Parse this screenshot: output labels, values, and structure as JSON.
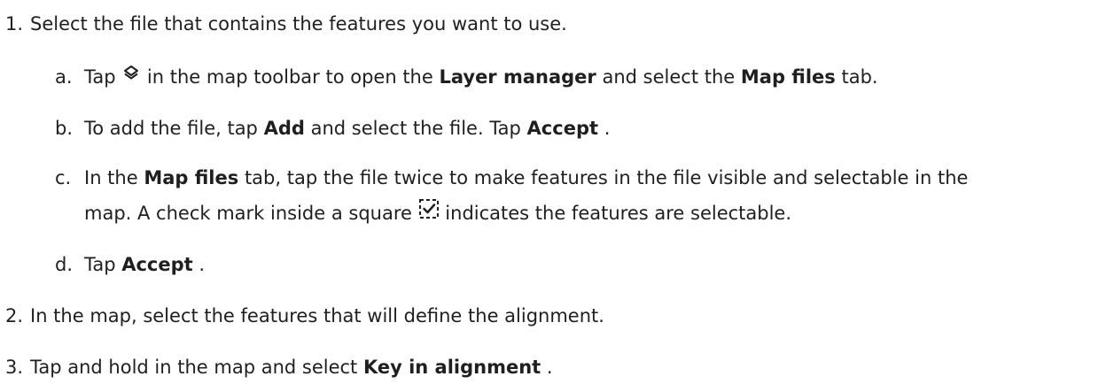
{
  "steps": [
    {
      "marker": "1.",
      "text": "Select the file that contains the features you want to use."
    },
    {
      "marker": "2.",
      "text": "In the map, select the features that will define the alignment."
    },
    {
      "marker": "3.",
      "text_before": "Tap and hold in the map and select ",
      "bold": "Key in alignment",
      "text_after": "."
    }
  ],
  "substeps": {
    "a": {
      "marker": "a.",
      "t1": "Tap ",
      "icon": "layers-icon",
      "t2": " in the map toolbar to open the ",
      "b1": "Layer manager",
      "t3": " and select the ",
      "b2": "Map files",
      "t4": " tab."
    },
    "b": {
      "marker": "b.",
      "t1": "To add the file, tap ",
      "b1": "Add",
      "t2": " and select the file. Tap ",
      "b2": "Accept",
      "t3": "."
    },
    "c": {
      "marker": "c.",
      "t1": "In the ",
      "b1": "Map files",
      "t2": " tab, tap the file twice to make features in the file visible and selectable in the",
      "line2_t1": "map. A check mark inside a square ",
      "icon": "selectable-checkbox-icon",
      "line2_t2": " indicates the features are selectable."
    },
    "d": {
      "marker": "d.",
      "t1": "Tap ",
      "b1": "Accept",
      "t2": "."
    }
  }
}
